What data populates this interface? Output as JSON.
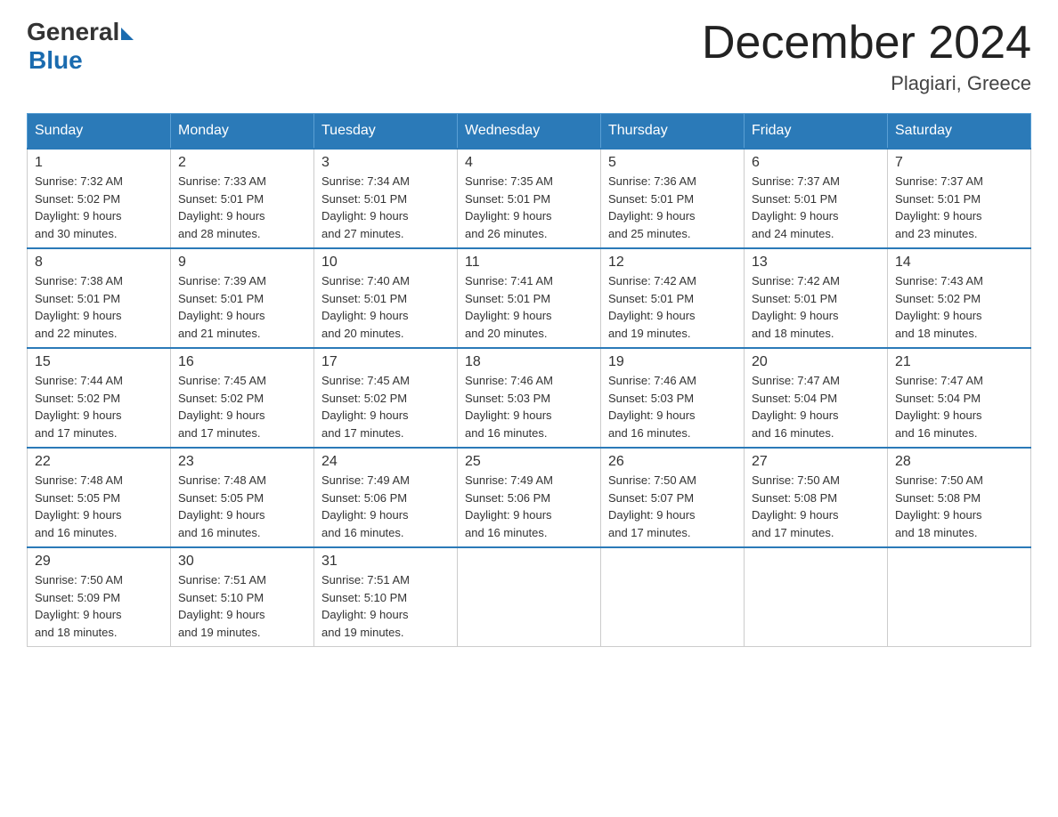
{
  "logo": {
    "general": "General",
    "blue": "Blue"
  },
  "title": {
    "month_year": "December 2024",
    "location": "Plagiari, Greece"
  },
  "days_header": [
    "Sunday",
    "Monday",
    "Tuesday",
    "Wednesday",
    "Thursday",
    "Friday",
    "Saturday"
  ],
  "weeks": [
    [
      {
        "day": "1",
        "sunrise": "7:32 AM",
        "sunset": "5:02 PM",
        "daylight": "9 hours and 30 minutes."
      },
      {
        "day": "2",
        "sunrise": "7:33 AM",
        "sunset": "5:01 PM",
        "daylight": "9 hours and 28 minutes."
      },
      {
        "day": "3",
        "sunrise": "7:34 AM",
        "sunset": "5:01 PM",
        "daylight": "9 hours and 27 minutes."
      },
      {
        "day": "4",
        "sunrise": "7:35 AM",
        "sunset": "5:01 PM",
        "daylight": "9 hours and 26 minutes."
      },
      {
        "day": "5",
        "sunrise": "7:36 AM",
        "sunset": "5:01 PM",
        "daylight": "9 hours and 25 minutes."
      },
      {
        "day": "6",
        "sunrise": "7:37 AM",
        "sunset": "5:01 PM",
        "daylight": "9 hours and 24 minutes."
      },
      {
        "day": "7",
        "sunrise": "7:37 AM",
        "sunset": "5:01 PM",
        "daylight": "9 hours and 23 minutes."
      }
    ],
    [
      {
        "day": "8",
        "sunrise": "7:38 AM",
        "sunset": "5:01 PM",
        "daylight": "9 hours and 22 minutes."
      },
      {
        "day": "9",
        "sunrise": "7:39 AM",
        "sunset": "5:01 PM",
        "daylight": "9 hours and 21 minutes."
      },
      {
        "day": "10",
        "sunrise": "7:40 AM",
        "sunset": "5:01 PM",
        "daylight": "9 hours and 20 minutes."
      },
      {
        "day": "11",
        "sunrise": "7:41 AM",
        "sunset": "5:01 PM",
        "daylight": "9 hours and 20 minutes."
      },
      {
        "day": "12",
        "sunrise": "7:42 AM",
        "sunset": "5:01 PM",
        "daylight": "9 hours and 19 minutes."
      },
      {
        "day": "13",
        "sunrise": "7:42 AM",
        "sunset": "5:01 PM",
        "daylight": "9 hours and 18 minutes."
      },
      {
        "day": "14",
        "sunrise": "7:43 AM",
        "sunset": "5:02 PM",
        "daylight": "9 hours and 18 minutes."
      }
    ],
    [
      {
        "day": "15",
        "sunrise": "7:44 AM",
        "sunset": "5:02 PM",
        "daylight": "9 hours and 17 minutes."
      },
      {
        "day": "16",
        "sunrise": "7:45 AM",
        "sunset": "5:02 PM",
        "daylight": "9 hours and 17 minutes."
      },
      {
        "day": "17",
        "sunrise": "7:45 AM",
        "sunset": "5:02 PM",
        "daylight": "9 hours and 17 minutes."
      },
      {
        "day": "18",
        "sunrise": "7:46 AM",
        "sunset": "5:03 PM",
        "daylight": "9 hours and 16 minutes."
      },
      {
        "day": "19",
        "sunrise": "7:46 AM",
        "sunset": "5:03 PM",
        "daylight": "9 hours and 16 minutes."
      },
      {
        "day": "20",
        "sunrise": "7:47 AM",
        "sunset": "5:04 PM",
        "daylight": "9 hours and 16 minutes."
      },
      {
        "day": "21",
        "sunrise": "7:47 AM",
        "sunset": "5:04 PM",
        "daylight": "9 hours and 16 minutes."
      }
    ],
    [
      {
        "day": "22",
        "sunrise": "7:48 AM",
        "sunset": "5:05 PM",
        "daylight": "9 hours and 16 minutes."
      },
      {
        "day": "23",
        "sunrise": "7:48 AM",
        "sunset": "5:05 PM",
        "daylight": "9 hours and 16 minutes."
      },
      {
        "day": "24",
        "sunrise": "7:49 AM",
        "sunset": "5:06 PM",
        "daylight": "9 hours and 16 minutes."
      },
      {
        "day": "25",
        "sunrise": "7:49 AM",
        "sunset": "5:06 PM",
        "daylight": "9 hours and 16 minutes."
      },
      {
        "day": "26",
        "sunrise": "7:50 AM",
        "sunset": "5:07 PM",
        "daylight": "9 hours and 17 minutes."
      },
      {
        "day": "27",
        "sunrise": "7:50 AM",
        "sunset": "5:08 PM",
        "daylight": "9 hours and 17 minutes."
      },
      {
        "day": "28",
        "sunrise": "7:50 AM",
        "sunset": "5:08 PM",
        "daylight": "9 hours and 18 minutes."
      }
    ],
    [
      {
        "day": "29",
        "sunrise": "7:50 AM",
        "sunset": "5:09 PM",
        "daylight": "9 hours and 18 minutes."
      },
      {
        "day": "30",
        "sunrise": "7:51 AM",
        "sunset": "5:10 PM",
        "daylight": "9 hours and 19 minutes."
      },
      {
        "day": "31",
        "sunrise": "7:51 AM",
        "sunset": "5:10 PM",
        "daylight": "9 hours and 19 minutes."
      },
      null,
      null,
      null,
      null
    ]
  ],
  "labels": {
    "sunrise": "Sunrise:",
    "sunset": "Sunset:",
    "daylight": "Daylight:"
  }
}
